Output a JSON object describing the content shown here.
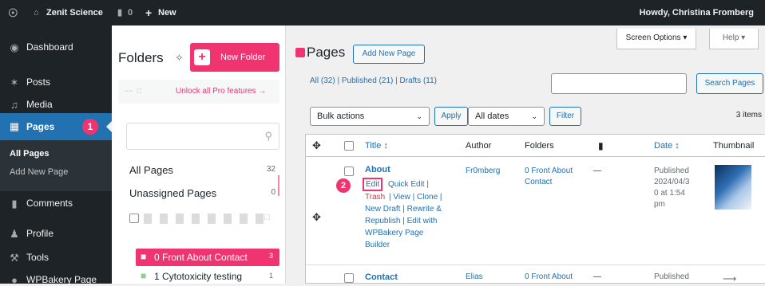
{
  "adminbar": {
    "site_name": "Zenit Science",
    "comments_count": "0",
    "new_label": "New",
    "howdy": "Howdy, Christina Fromberg"
  },
  "sidebar": {
    "dashboard": "Dashboard",
    "posts": "Posts",
    "media": "Media",
    "pages": "Pages",
    "pages_badge": "1",
    "all_pages": "All Pages",
    "add_new_page": "Add New Page",
    "comments": "Comments",
    "profile": "Profile",
    "tools": "Tools",
    "wpbakery": "WPBakery Page"
  },
  "folders": {
    "title": "Folders",
    "new_folder": "New Folder",
    "unlock": "Unlock all Pro features →",
    "all_pages_label": "All Pages",
    "all_pages_count": "32",
    "unassigned_label": "Unassigned Pages",
    "unassigned_count": "0",
    "items": [
      {
        "label": "0 Front About Contact",
        "count": "3"
      },
      {
        "label": "1 Cytotoxicity testing",
        "count": "1"
      }
    ]
  },
  "main": {
    "title": "Pages",
    "add_new": "Add New Page",
    "screen_options": "Screen Options ▾",
    "help": "Help ▾",
    "filter_links": {
      "all": "All (32)",
      "sep1": "|",
      "published": "Published (21)",
      "sep2": "|",
      "drafts": "Drafts (11)"
    },
    "search_button": "Search Pages",
    "bulk_actions": "Bulk actions",
    "apply": "Apply",
    "all_dates": "All dates",
    "filter": "Filter",
    "items_count": "3 items",
    "columns": {
      "title": "Title ↕",
      "author": "Author",
      "folders": "Folders",
      "date": "Date ↕",
      "thumbnail": "Thumbnail"
    },
    "rows": [
      {
        "title": "About",
        "author": "Fr0mberg",
        "folder_line1": "0 Front About",
        "folder_line2": "Contact",
        "comments": "—",
        "date_line1": "Published",
        "date_line2": "2024/04/3",
        "date_line3": "0 at 1:54",
        "date_line4": "pm",
        "edit": "Edit",
        "quick_edit": "Quick Edit |",
        "trash": "Trash",
        "view": "| View | Clone |",
        "line3": "New Draft | Rewrite &",
        "line4": "Republish | Edit with",
        "line5": "WPBakery Page",
        "line6": "Builder",
        "step_badge": "2"
      },
      {
        "title": "Contact",
        "author": "Elias",
        "folder_line1": "0 Front About",
        "comments": "—",
        "date_line1": "Published"
      }
    ]
  },
  "colors": {
    "accent": "#2271b1",
    "pink": "#f0346f",
    "adminbar": "#1d2327",
    "danger": "#d63638"
  }
}
